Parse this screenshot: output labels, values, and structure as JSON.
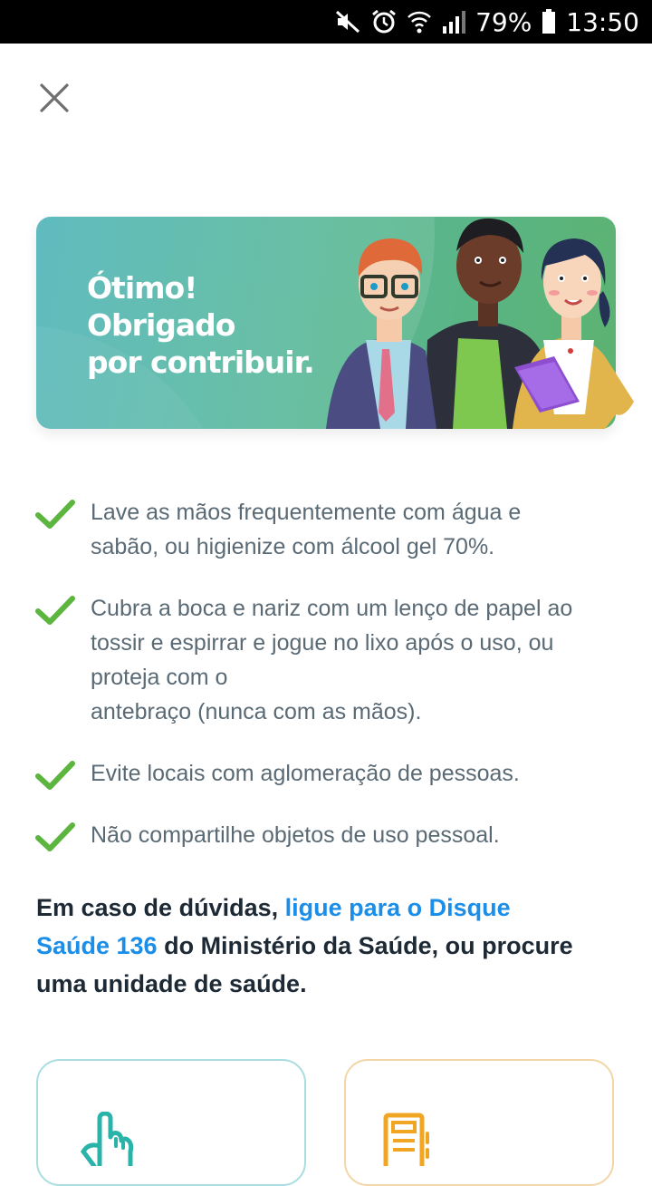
{
  "status_bar": {
    "battery": "79%",
    "time": "13:50",
    "icons": [
      "mute-icon",
      "alarm-icon",
      "wifi-icon",
      "signal-icon",
      "battery-icon"
    ]
  },
  "close": {
    "icon": "close-icon"
  },
  "banner": {
    "line1": "Ótimo!",
    "line2": "Obrigado",
    "line3": "por contribuir."
  },
  "tips": [
    {
      "lines": [
        "Lave as mãos frequentemente com água e",
        "sabão, ou higienize com álcool gel 70%."
      ]
    },
    {
      "lines": [
        "Cubra a boca e nariz com um lenço de papel ao",
        "tossir e espirrar e jogue no lixo após o uso, ou",
        "proteja com o",
        "antebraço (nunca com as mãos)."
      ]
    },
    {
      "lines": [
        "Evite locais com aglomeração de pessoas."
      ]
    },
    {
      "lines": [
        "Não compartilhe objetos de uso pessoal."
      ]
    }
  ],
  "help": {
    "prefix": "Em caso de dúvidas, ",
    "link_line1": "ligue para o Disque",
    "link_line2": "Saúde 136",
    "suffix": " do Ministério da Saúde, ou procure",
    "line3": "uma unidade de saúde."
  },
  "cards": [
    {
      "icon": "pointing-hand-icon"
    },
    {
      "icon": "document-icon"
    }
  ],
  "colors": {
    "check": "#5cb53e",
    "link": "#1a8ee8",
    "text": "#5a6a75",
    "heading": "#1d2a36"
  }
}
